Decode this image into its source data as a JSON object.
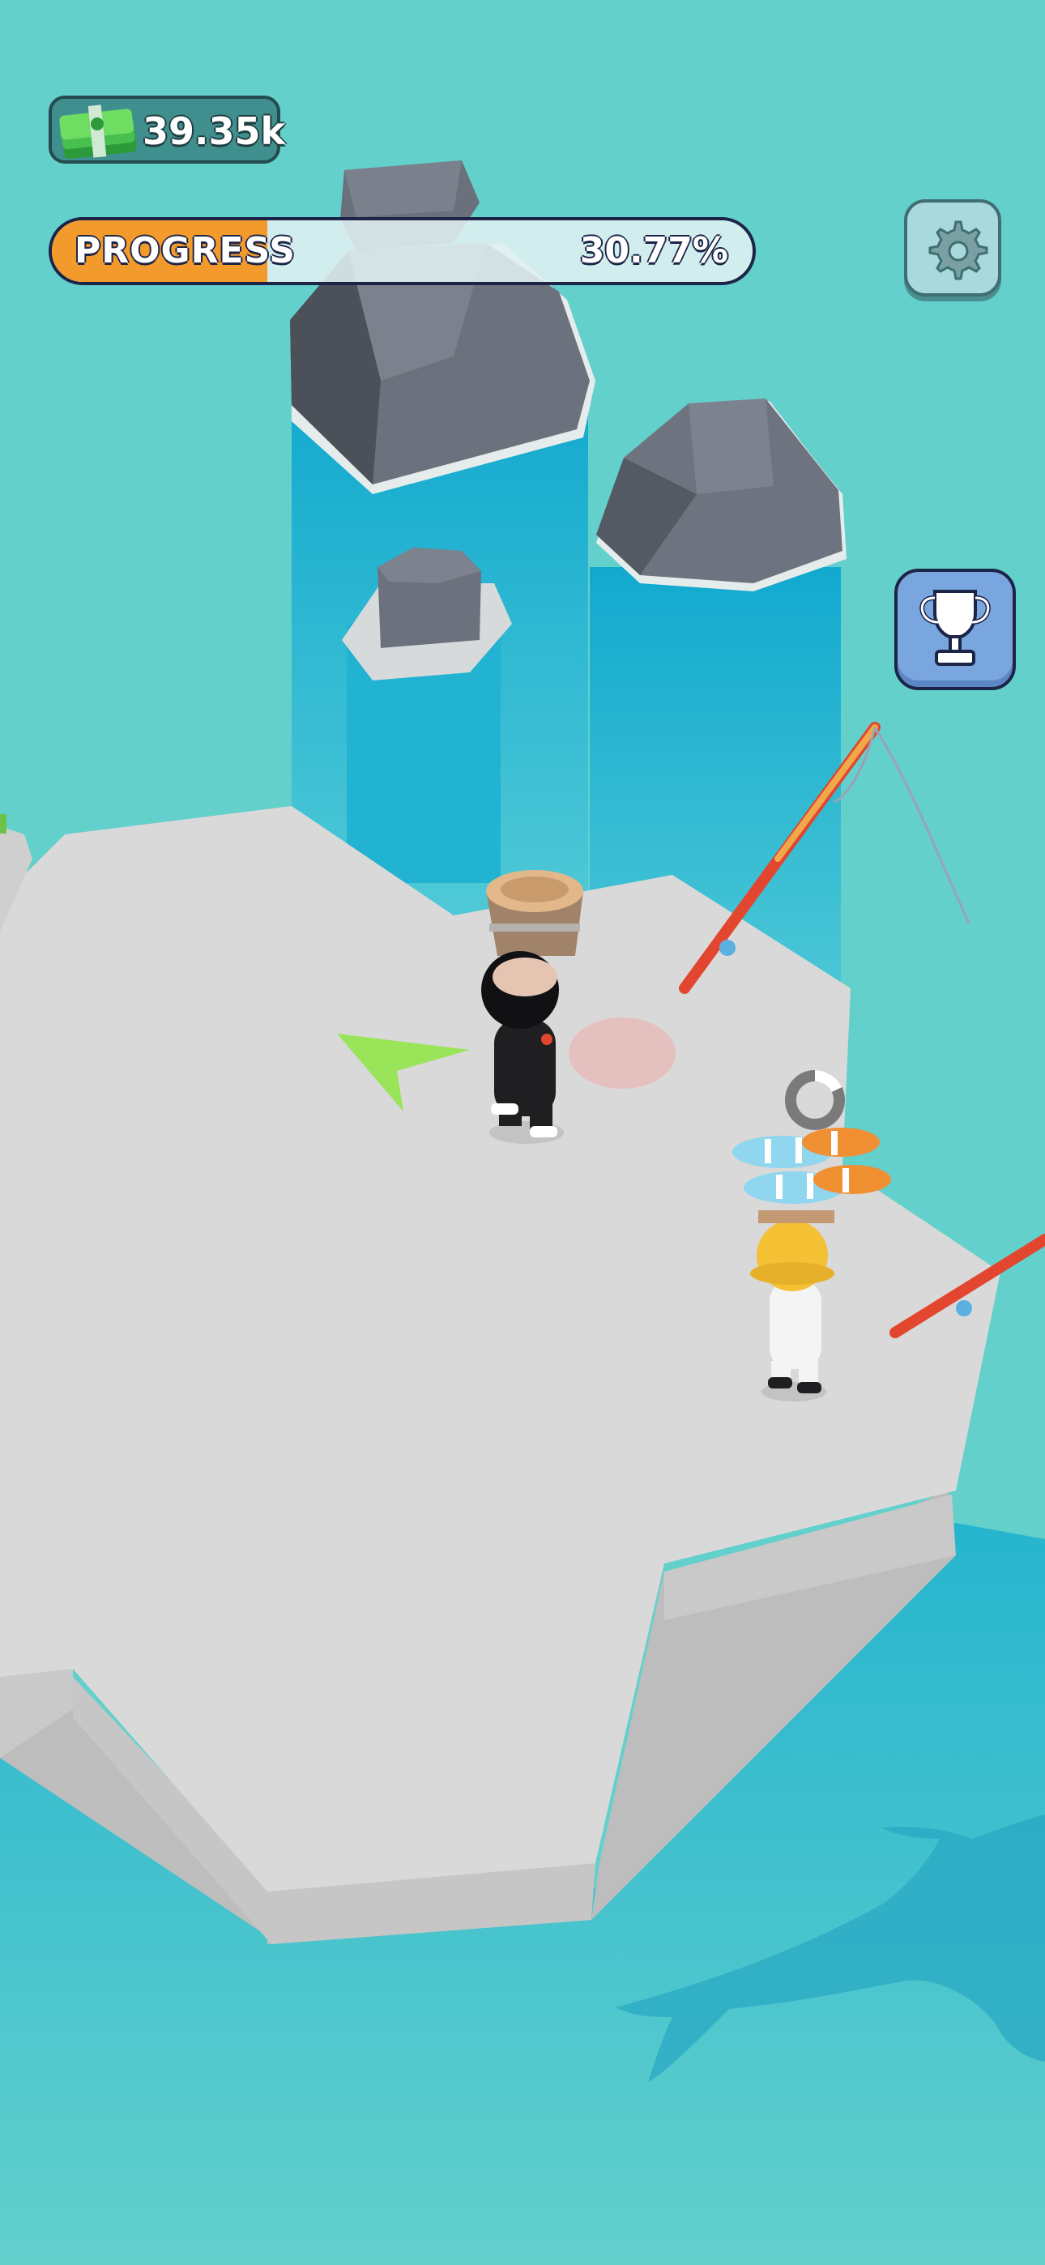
{
  "hud": {
    "money": {
      "value": "39.35k",
      "icon": "cash-stack-icon"
    },
    "progress": {
      "label": "PROGRESS",
      "value": "30.77%",
      "fraction": 0.3077,
      "fill_color": "#f39a2c"
    },
    "settings": {
      "icon": "gear-icon"
    },
    "leaderboard": {
      "icon": "trophy-icon"
    }
  },
  "scene": {
    "water_color": "#63d0cc",
    "deep_water_color": "#1bb1d0",
    "platform_color": "#d9d9d9",
    "rock_color": "#6c7480",
    "player": {
      "outfit": "black suit"
    },
    "worker": {
      "outfit": "white with yellow hat",
      "carrying": "fish-stack"
    },
    "target_marker_color": "#e6b9b7",
    "direction_arrow_color": "#9ae45a"
  }
}
